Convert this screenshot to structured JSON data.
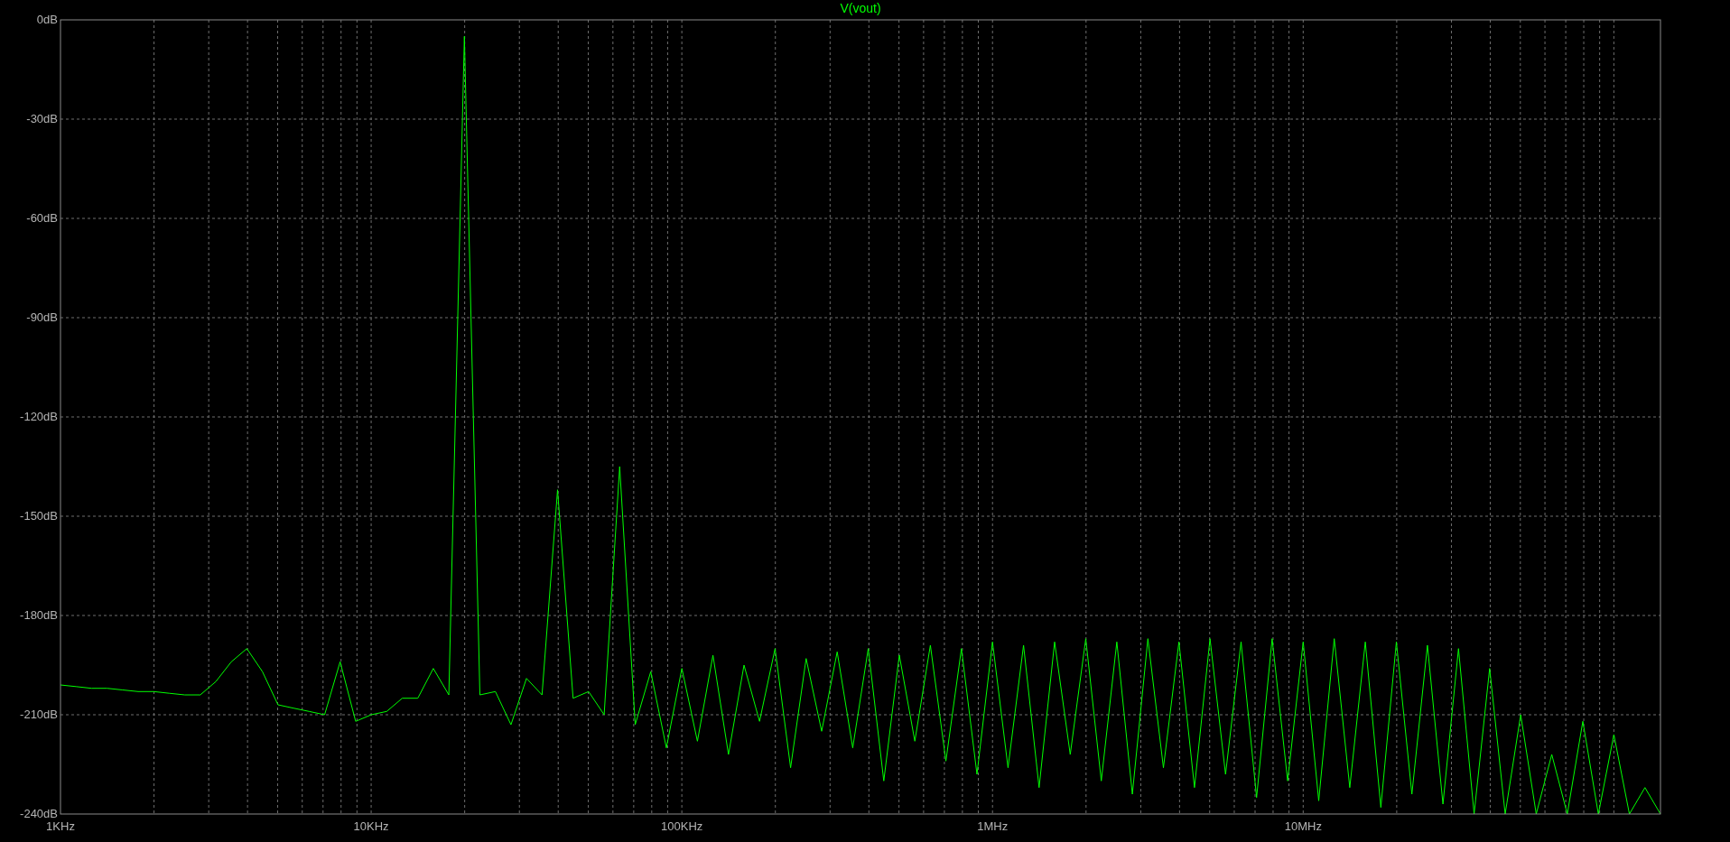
{
  "plot": {
    "chart_data": {
      "type": "line",
      "grid": true,
      "ylim": [
        -240,
        0
      ],
      "yticks": [
        {
          "value": 0,
          "label": "0dB"
        },
        {
          "value": -30,
          "label": "-30dB"
        },
        {
          "value": -60,
          "label": "-60dB"
        },
        {
          "value": -90,
          "label": "-90dB"
        },
        {
          "value": -120,
          "label": "-120dB"
        },
        {
          "value": -150,
          "label": "-150dB"
        },
        {
          "value": -180,
          "label": "-180dB"
        },
        {
          "value": -210,
          "label": "-210dB"
        },
        {
          "value": -240,
          "label": "-240dB"
        }
      ],
      "categories": [
        "1KHz",
        null,
        null,
        null,
        null,
        null,
        null,
        null,
        null,
        null,
        null,
        null,
        null,
        null,
        null,
        null,
        null,
        null,
        null,
        null,
        "10KHz",
        null,
        null,
        null,
        null,
        null,
        null,
        null,
        null,
        null,
        null,
        null,
        null,
        null,
        null,
        null,
        null,
        null,
        null,
        null,
        "100KHz",
        null,
        null,
        null,
        null,
        null,
        null,
        null,
        null,
        null,
        null,
        null,
        null,
        null,
        null,
        null,
        null,
        null,
        null,
        null,
        "1MHz",
        null,
        null,
        null,
        null,
        null,
        null,
        null,
        null,
        null,
        null,
        null,
        null,
        null,
        null,
        null,
        null,
        null,
        null,
        null,
        "10MHz",
        null,
        null,
        null,
        null,
        null,
        null,
        null,
        null,
        null,
        null,
        null,
        null,
        null,
        null,
        null,
        null,
        null,
        null,
        null,
        null,
        null,
        null,
        null
      ],
      "series": [
        {
          "name": "V(vout)",
          "color": "#00ff00",
          "values": [
            -201,
            -201.5,
            -202,
            -202,
            -202.5,
            -203,
            -203,
            -203.5,
            -204,
            -204,
            -200,
            -194,
            -190,
            -197,
            -207,
            -208,
            -209,
            -210,
            -194,
            -212,
            -210,
            -209,
            -205,
            -205,
            -196,
            -204,
            -5,
            -204,
            -203,
            -213,
            -199,
            -204,
            -142,
            -205,
            -203,
            -210,
            -135,
            -213,
            -197,
            -220,
            -196,
            -218,
            -192,
            -222,
            -195,
            -212,
            -190,
            -226,
            -193,
            -215,
            -191,
            -220,
            -190,
            -230,
            -192,
            -218,
            -189,
            -224,
            -190,
            -228,
            -188,
            -226,
            -189,
            -232,
            -188,
            -222,
            -187,
            -230,
            -188,
            -234,
            -187,
            -226,
            -188,
            -232,
            -187,
            -228,
            -188,
            -235,
            -187,
            -230,
            -188,
            -236,
            -187,
            -232,
            -188,
            -238,
            -188,
            -234,
            -189,
            -237,
            -190,
            -240,
            -196,
            -240,
            -210,
            -240,
            -222,
            -240,
            -212,
            -240,
            -216,
            -240,
            -232,
            -240
          ]
        }
      ]
    }
  }
}
